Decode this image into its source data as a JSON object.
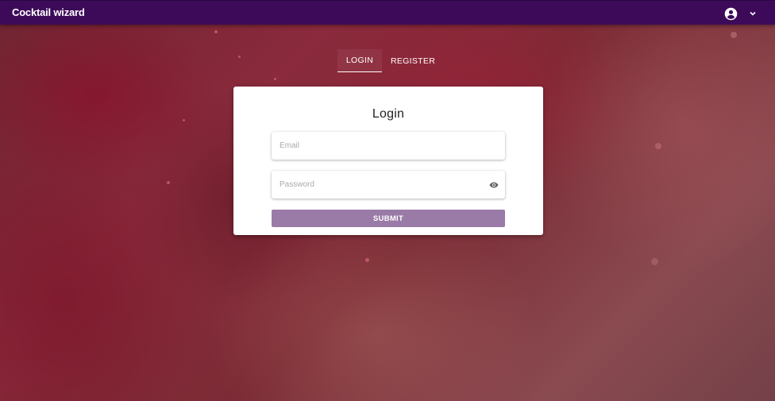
{
  "app": {
    "title": "Cocktail wizard"
  },
  "header": {
    "account_icon": "account-circle-icon",
    "menu_icon": "chevron-down-icon"
  },
  "tabs": [
    {
      "label": "LOGIN",
      "active": true
    },
    {
      "label": "REGISTER",
      "active": false
    }
  ],
  "login_form": {
    "title": "Login",
    "email_placeholder": "Email",
    "email_value": "",
    "password_placeholder": "Password",
    "password_value": "",
    "password_toggle_icon": "eye-icon",
    "submit_label": "SUBMIT"
  },
  "colors": {
    "appbar": "#3d0a5a",
    "submit_button": "#9a7aa7",
    "card": "#ffffff",
    "background_tone": "#7a2a35"
  }
}
